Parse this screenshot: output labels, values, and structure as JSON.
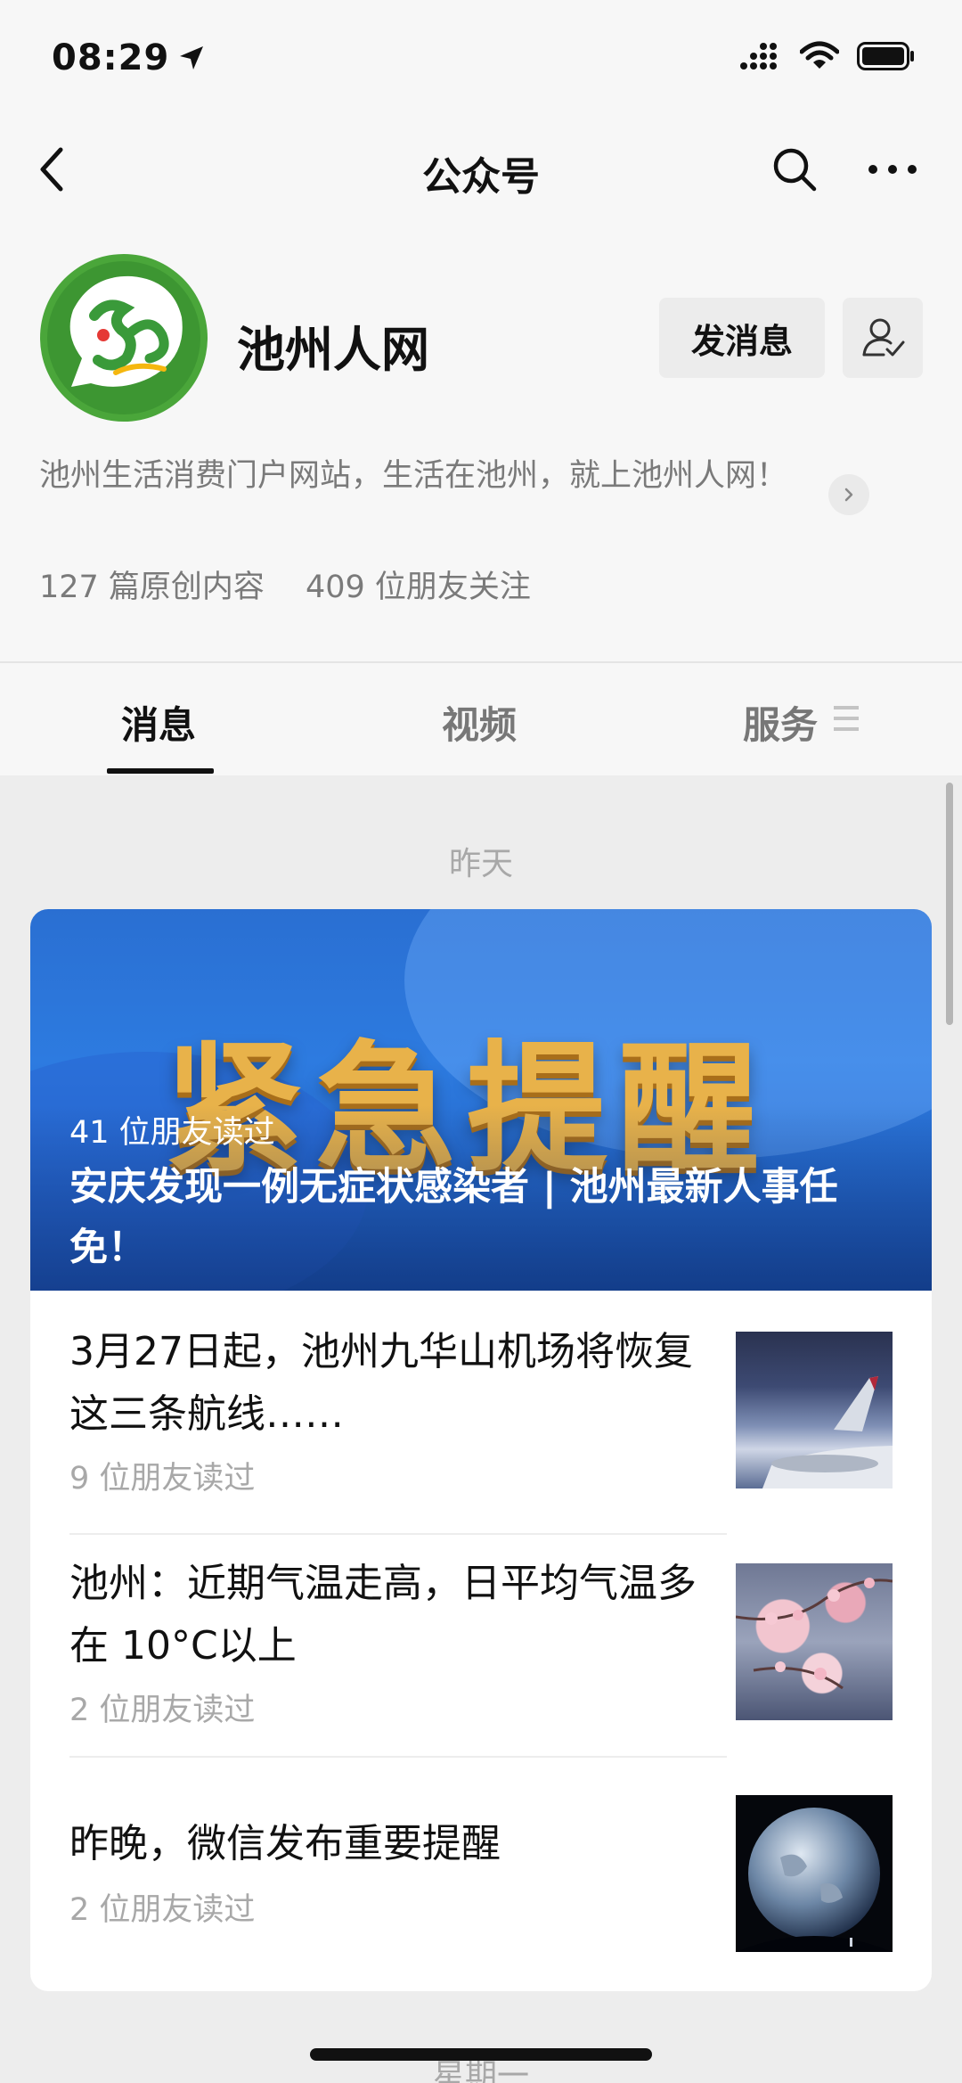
{
  "status": {
    "time": "08:29"
  },
  "nav": {
    "title": "公众号"
  },
  "profile": {
    "name": "池州人网",
    "send_message_label": "发消息",
    "description": "池州生活消费门户网站，生活在池州，就上池州人网！",
    "original_count": "127 篇原创内容",
    "followers": "409 位朋友关注"
  },
  "tabs": [
    {
      "label": "消息"
    },
    {
      "label": "视频"
    },
    {
      "label": "服务"
    }
  ],
  "feed": {
    "date_label": "昨天",
    "cover": {
      "image_text": "紧急提醒",
      "reads": "41 位朋友读过",
      "title": "安庆发现一例无症状感染者 | 池州最新人事任免！"
    },
    "articles": [
      {
        "title": "3月27日起，池州九华山机场将恢复这三条航线……",
        "reads": "9 位朋友读过"
      },
      {
        "title": "池州：近期气温走高，日平均气温多在 10°C以上",
        "reads": "2 位朋友读过"
      },
      {
        "title": "昨晚，微信发布重要提醒",
        "reads": "2 位朋友读过"
      }
    ],
    "next_date_label": "星期一"
  },
  "colors": {
    "accent_green": "#3a9a3a",
    "cover_blue": "#2d7be0",
    "cover_gold": "#e8b24a"
  }
}
